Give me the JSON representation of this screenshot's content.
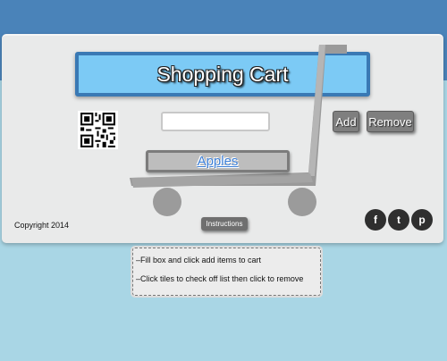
{
  "header": {
    "title": "Shopping Cart"
  },
  "input": {
    "value": "",
    "placeholder": ""
  },
  "buttons": {
    "add": "Add",
    "remove": "Remove",
    "instructions": "Instructions"
  },
  "items": [
    {
      "label": "Apples"
    }
  ],
  "footer": {
    "copyright": "Copyright 2014"
  },
  "social": [
    {
      "icon": "facebook-icon",
      "glyph": "f"
    },
    {
      "icon": "twitter-icon",
      "glyph": "t"
    },
    {
      "icon": "pinterest-icon",
      "glyph": "p"
    }
  ],
  "instructions": [
    "–Fill box and click add items to cart",
    "–Click tiles to check off list then click to remove"
  ],
  "colors": {
    "accent": "#3a79b4",
    "title_bg": "#7ccaf5",
    "page_bg": "#a9d6e5",
    "topbar": "#4a83b9"
  }
}
